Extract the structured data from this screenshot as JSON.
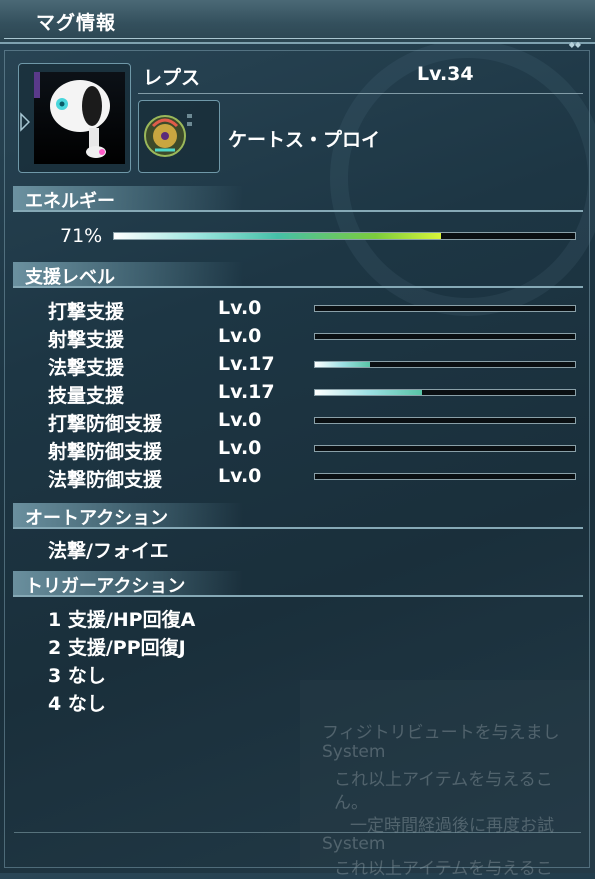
{
  "window": {
    "title": "マグ情報"
  },
  "mag": {
    "name": "レプス",
    "level": "Lv.34",
    "photon_blast": "ケートス・プロイ"
  },
  "energy": {
    "header": "エネルギー",
    "value_text": "71%",
    "percent": 71
  },
  "support": {
    "header": "支援レベル",
    "items": [
      {
        "name": "打撃支援",
        "level": "Lv.0",
        "fill": 0
      },
      {
        "name": "射撃支援",
        "level": "Lv.0",
        "fill": 0
      },
      {
        "name": "法撃支援",
        "level": "Lv.17",
        "fill": 0.21
      },
      {
        "name": "技量支援",
        "level": "Lv.17",
        "fill": 0.41
      },
      {
        "name": "打撃防御支援",
        "level": "Lv.0",
        "fill": 0
      },
      {
        "name": "射撃防御支援",
        "level": "Lv.0",
        "fill": 0
      },
      {
        "name": "法撃防御支援",
        "level": "Lv.0",
        "fill": 0
      }
    ]
  },
  "auto_action": {
    "header": "オートアクション",
    "value": "法撃/フォイエ"
  },
  "trigger_action": {
    "header": "トリガーアクション",
    "items": [
      "1 支援/HP回復A",
      "2 支援/PP回復J",
      "3 なし",
      "4 なし"
    ]
  },
  "background_log": {
    "lines": [
      "フィジトリビュートを与えまし",
      "System",
      "これ以上アイテムを与えるこ",
      "ん。",
      "一定時間経過後に再度お試",
      "System",
      "これ以上アイテムを与えるこ"
    ]
  },
  "colors": {
    "accent": "#86a9b6",
    "energy_tip": "#d7f43a",
    "support_fill": "#58c4a6"
  }
}
